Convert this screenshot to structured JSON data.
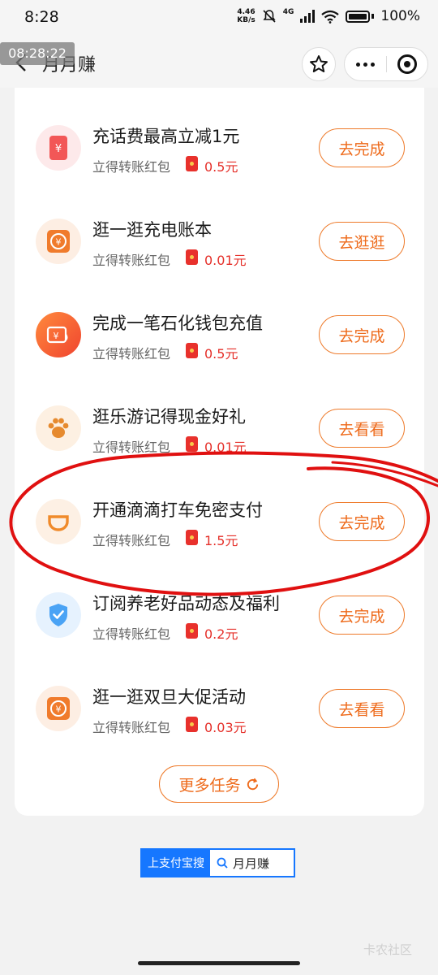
{
  "status_bar": {
    "time": "8:28",
    "net_speed_value": "4.46",
    "net_speed_unit": "KB/s",
    "network": "4G",
    "battery": "100%"
  },
  "nav": {
    "overlay_time": "08:28:22",
    "title": "月月赚"
  },
  "tasks": [
    {
      "title": "充话费最高立减1元",
      "sub": "立得转账红包",
      "amount": "0.5元",
      "button": "去完成",
      "icon": "phone-bill-icon"
    },
    {
      "title": "逛一逛充电账本",
      "sub": "立得转账红包",
      "amount": "0.01元",
      "button": "去逛逛",
      "icon": "yuan-box-icon"
    },
    {
      "title": "完成一笔石化钱包充值",
      "sub": "立得转账红包",
      "amount": "0.5元",
      "button": "去完成",
      "icon": "fuel-wallet-icon"
    },
    {
      "title": "逛乐游记得现金好礼",
      "sub": "立得转账红包",
      "amount": "0.01元",
      "button": "去看看",
      "icon": "paw-icon"
    },
    {
      "title": "开通滴滴打车免密支付",
      "sub": "立得转账红包",
      "amount": "1.5元",
      "button": "去完成",
      "icon": "didi-icon"
    },
    {
      "title": "订阅养老好品动态及福利",
      "sub": "立得转账红包",
      "amount": "0.2元",
      "button": "去完成",
      "icon": "shield-check-icon"
    },
    {
      "title": "逛一逛双旦大促活动",
      "sub": "立得转账红包",
      "amount": "0.03元",
      "button": "去看看",
      "icon": "yuan-box-icon"
    }
  ],
  "more_tasks": "更多任务",
  "search_banner": {
    "label": "上支付宝搜",
    "keyword": "月月赚"
  },
  "watermark": "卡农社区",
  "colors": {
    "accent_orange": "#ee6a1a",
    "amount_red": "#e5302a",
    "alipay_blue": "#1677ff",
    "annotation_red": "#e01010"
  }
}
